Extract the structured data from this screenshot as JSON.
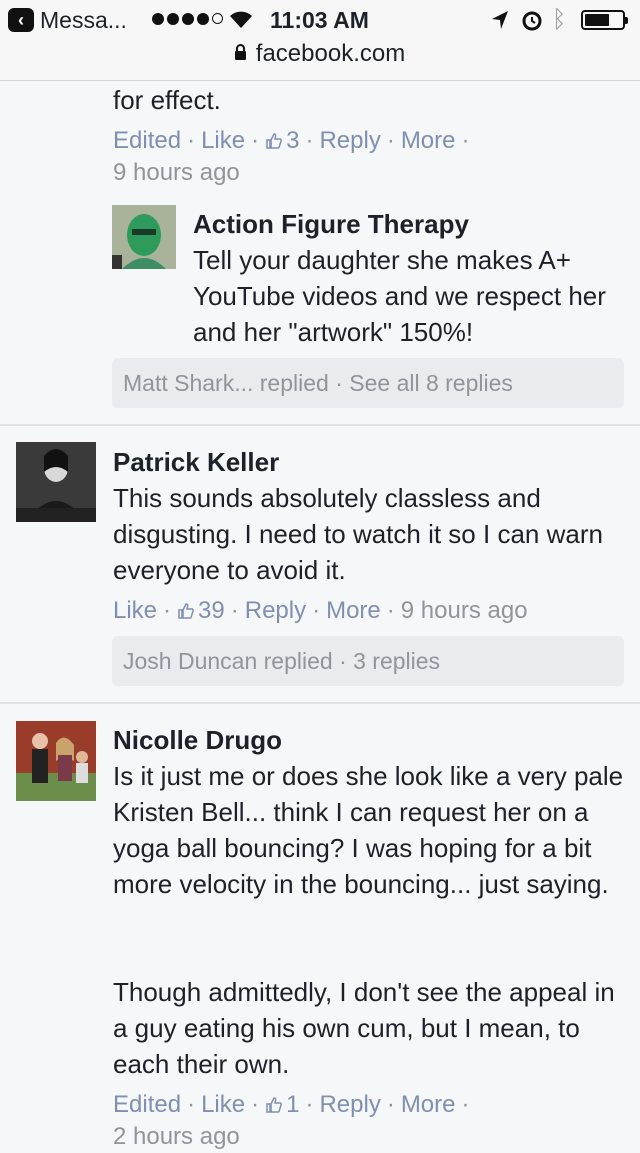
{
  "status": {
    "back_app": "Messa...",
    "time": "11:03 AM",
    "url": "facebook.com"
  },
  "top_comment": {
    "text_tail": "for effect.",
    "meta": {
      "edited": "Edited",
      "like": "Like",
      "like_count": "3",
      "reply": "Reply",
      "more": "More",
      "time": "9 hours ago"
    }
  },
  "reply_preview": {
    "name": "Action Figure Therapy",
    "text": "Tell your daughter she makes A+ YouTube videos and we respect her and her \"artwork\" 150%!",
    "summary": "Matt Shark... replied · See all 8 replies"
  },
  "comments": [
    {
      "name": "Patrick Keller",
      "text": "This sounds absolutely classless and disgusting. I need to watch it so I can warn everyone to avoid it.",
      "meta": {
        "like": "Like",
        "like_count": "39",
        "reply": "Reply",
        "more": "More",
        "time": "9 hours ago"
      },
      "replies": "Josh Duncan replied · 3 replies"
    },
    {
      "name": "Nicolle Drugo",
      "text_p1": "Is it just me or does she look like a very pale Kristen Bell... think I can request her on a yoga ball bouncing? I was hoping for a bit more velocity in the bouncing... just saying.",
      "text_p2": "Though admittedly, I don't see the appeal in a guy eating his own cum, but I mean, to each their own.",
      "meta": {
        "edited": "Edited",
        "like": "Like",
        "like_count": "1",
        "reply": "Reply",
        "more": "More",
        "time": "2 hours ago"
      }
    }
  ],
  "colors": {
    "link": "#7f8fb3",
    "meta": "#90949c",
    "background": "#f6f7f9",
    "reply_box": "#e9ebee"
  }
}
